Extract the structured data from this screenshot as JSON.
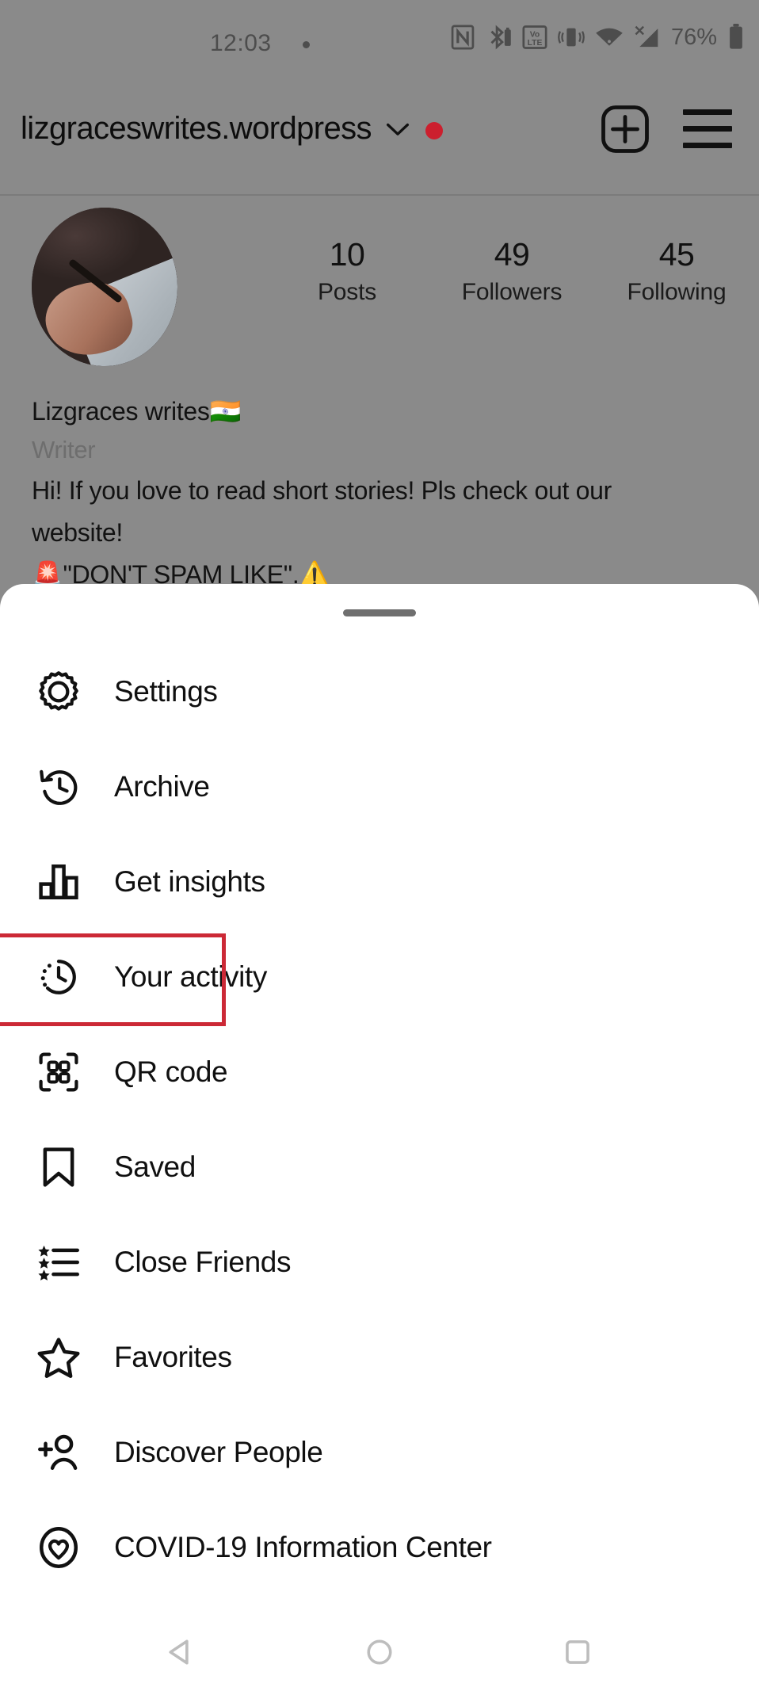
{
  "status_bar": {
    "time": "12:03",
    "battery_percent": "76%",
    "icons": [
      "nfc-icon",
      "bluetooth-icon",
      "volte-icon",
      "vibrate-icon",
      "wifi-icon",
      "signal-icon",
      "battery-icon"
    ]
  },
  "topbar": {
    "site_title": "lizgraceswrites.wordpress",
    "dropdown_icon": "chevron-down-icon",
    "unread_indicator": "red-dot",
    "add_icon": "plus-box-icon",
    "menu_icon": "hamburger-icon"
  },
  "profile": {
    "avatar": "profile-photo",
    "stats": [
      {
        "value": "10",
        "label": "Posts"
      },
      {
        "value": "49",
        "label": "Followers"
      },
      {
        "value": "45",
        "label": "Following"
      }
    ],
    "display_name": "Lizgraces writes🇮🇳",
    "category": "Writer",
    "bio_line_1": "Hi! If you love to read short stories! Pls check out our",
    "bio_line_2": "website!",
    "bio_line_3": "🚨\"DON'T SPAM LIKE\".⚠️"
  },
  "sheet": {
    "handle": "drag-handle",
    "highlight_color": "#cc2936",
    "items": [
      {
        "label": "Settings",
        "icon": "gear-icon",
        "highlighted": false
      },
      {
        "label": "Archive",
        "icon": "archive-clock-icon",
        "highlighted": false
      },
      {
        "label": "Get insights",
        "icon": "bar-chart-icon",
        "highlighted": false
      },
      {
        "label": "Your activity",
        "icon": "activity-clock-icon",
        "highlighted": true
      },
      {
        "label": "QR code",
        "icon": "qr-code-icon",
        "highlighted": false
      },
      {
        "label": "Saved",
        "icon": "bookmark-icon",
        "highlighted": false
      },
      {
        "label": "Close Friends",
        "icon": "star-list-icon",
        "highlighted": false
      },
      {
        "label": "Favorites",
        "icon": "star-icon",
        "highlighted": false
      },
      {
        "label": "Discover People",
        "icon": "person-add-icon",
        "highlighted": false
      },
      {
        "label": "COVID-19 Information Center",
        "icon": "heart-circle-icon",
        "highlighted": false
      }
    ]
  },
  "navbar": {
    "back": "back-triangle-icon",
    "home": "home-circle-icon",
    "recents": "recents-square-icon"
  }
}
